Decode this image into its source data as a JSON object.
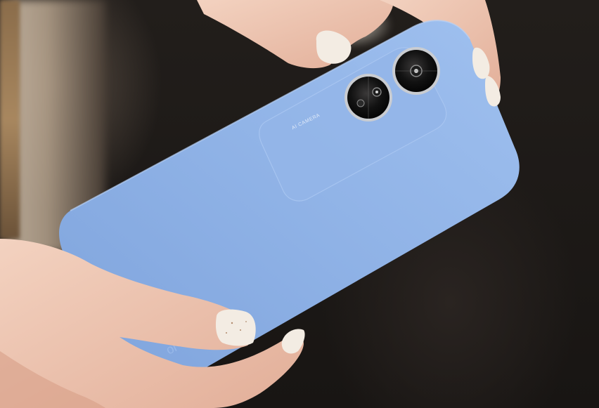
{
  "phone": {
    "color": "#8fb2e6",
    "camera_label": "AI CAMERA"
  },
  "colors": {
    "background": "#1a1716",
    "skin": "#f1c9b6",
    "nail": "#f3ece3"
  }
}
